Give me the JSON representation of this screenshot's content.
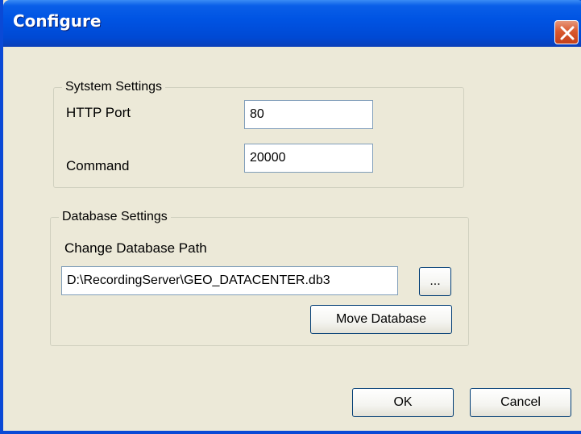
{
  "window": {
    "title": "Configure"
  },
  "system_settings": {
    "group_label": "Sytstem Settings",
    "http_port_label": "HTTP Port",
    "http_port_value": "80",
    "command_label": "Command",
    "command_value": "20000"
  },
  "database_settings": {
    "group_label": "Database Settings",
    "path_label": "Change Database Path",
    "path_value": "D:\\RecordingServer\\GEO_DATACENTER.db3",
    "browse_label": "...",
    "move_label": "Move Database"
  },
  "footer": {
    "ok_label": "OK",
    "cancel_label": "Cancel"
  },
  "icons": {
    "close": "close-icon"
  },
  "colors": {
    "titlebar": "#0054e3",
    "close_button": "#d9592f",
    "dialog_background": "#ece9d8"
  }
}
